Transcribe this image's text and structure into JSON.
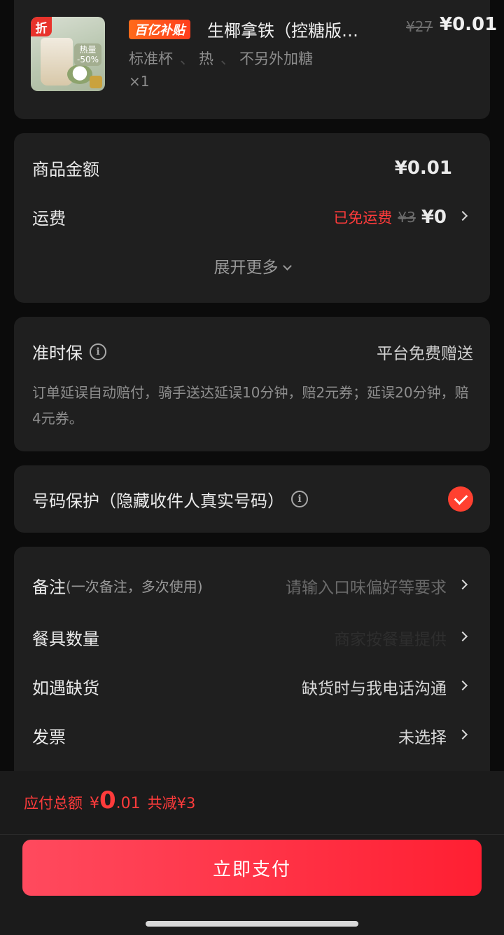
{
  "product": {
    "thumb_tag": "折",
    "thumb_badge": "热量\n-50%",
    "subsidy_tag": "百亿补贴",
    "name": "生椰拿铁（控糖版…",
    "original_price": "¥27",
    "price": "¥0.01",
    "specs": [
      "标准杯",
      "热",
      "不另外加糖"
    ],
    "quantity": "×1"
  },
  "amounts": {
    "goods_label": "商品金额",
    "goods_value": "¥0.01",
    "shipping_label": "运费",
    "shipping_free": "已免运费",
    "shipping_original": "¥3",
    "shipping_value": "¥0",
    "expand_label": "展开更多"
  },
  "ontime": {
    "title": "准时保",
    "right": "平台免费赠送",
    "desc": "订单延误自动赔付，骑手送达延误10分钟，赔2元券；延误20分钟，赔4元券。"
  },
  "privacy": {
    "label": "号码保护（隐藏收件人真实号码）",
    "checked": true
  },
  "notes": {
    "remark_label": "备注",
    "remark_sub": "(一次备注，多次使用)",
    "remark_placeholder": "请输入口味偏好等要求",
    "cutlery_label": "餐具数量",
    "cutlery_value": "商家按餐量提供",
    "stockout_label": "如遇缺货",
    "stockout_value": "缺货时与我电话沟通",
    "invoice_label": "发票",
    "invoice_value": "未选择"
  },
  "footer": {
    "total_label": "应付总额",
    "currency": "¥",
    "total_int": "0",
    "total_dec": ".01",
    "saved": "共减¥3",
    "pay_button": "立即支付"
  },
  "colors": {
    "accent_red": "#ff3b3b",
    "pay_gradient_start": "#ff4a5e",
    "pay_gradient_end": "#ff1f32",
    "card_bg": "#1f1f1f"
  }
}
